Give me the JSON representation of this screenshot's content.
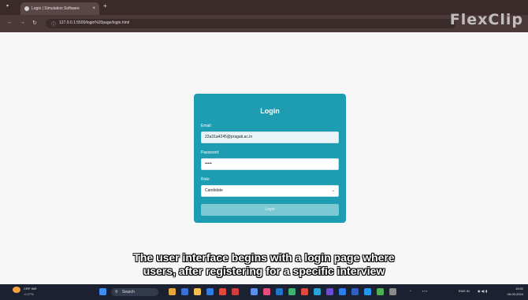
{
  "browser": {
    "tab_title": "Login | Simulation Software",
    "tab_close": "×",
    "new_tab": "+",
    "url": "127.0.0.1:5500/login%20page/login.html",
    "watermark": "FlexClip"
  },
  "login": {
    "title": "Login",
    "email_label": "Email:",
    "email_value": "22a31a4245@pragati.ac.in",
    "password_label": "Password:",
    "password_value": "•••••",
    "role_label": "Role:",
    "role_value": "Candidate",
    "button_label": "Login",
    "card_color": "#1e9cb1"
  },
  "caption": {
    "line1": "The user interface begins with a login page where",
    "line2": "users, after registering for a specific interview"
  },
  "taskbar": {
    "weather_temp": "CRP INR",
    "weather_sub": "-0.27%",
    "search_label": "Search",
    "language": "ENG IN",
    "time": "19:52",
    "date": "06-09-2024"
  }
}
